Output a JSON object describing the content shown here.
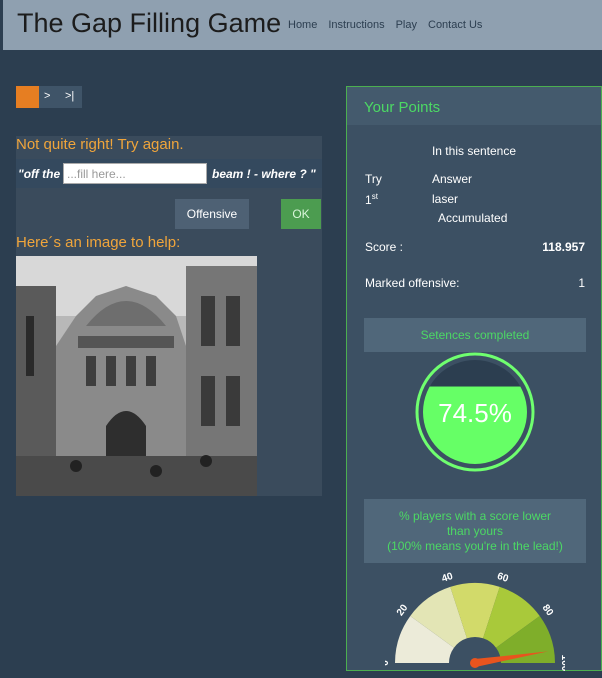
{
  "header": {
    "title": "The Gap Filling Game",
    "nav": [
      "Home",
      "Instructions",
      "Play",
      "Contact Us"
    ]
  },
  "progress": {
    "next_label": ">",
    "last_label": ">|",
    "current_color": "#e67e22"
  },
  "question": {
    "feedback": "Not quite right! Try again.",
    "sentence_before": "\"off the",
    "input_placeholder": "...fill here...",
    "input_value": "",
    "sentence_after": "beam ! - where ? \"",
    "offensive_label": "Offensive",
    "ok_label": "OK",
    "help_heading": "Here´s an image to help:"
  },
  "points": {
    "title": "Your Points",
    "subtitle": "In this sentence",
    "col_try": "Try",
    "col_answer": "Answer",
    "try_num": "1",
    "try_suffix": "st",
    "answer_value": "laser",
    "accumulated_label": "Accumulated",
    "score_label": "Score :",
    "score_value": "118.957",
    "offensive_label": "Marked offensive:",
    "offensive_value": "1",
    "completed_title": "Setences completed",
    "completed_value": "74.5%",
    "completed_fraction": 0.745,
    "players_title_1": "% players with a score lower",
    "players_title_2": "than yours",
    "players_title_3": "(100% means you're in the lead!)",
    "gauge_ticks": [
      "0",
      "20",
      "40",
      "60",
      "80",
      "100"
    ],
    "gauge_value": 95
  },
  "colors": {
    "accent_green": "#4cd964",
    "feedback_orange": "#f0a53b",
    "needle": "#e8541e"
  }
}
